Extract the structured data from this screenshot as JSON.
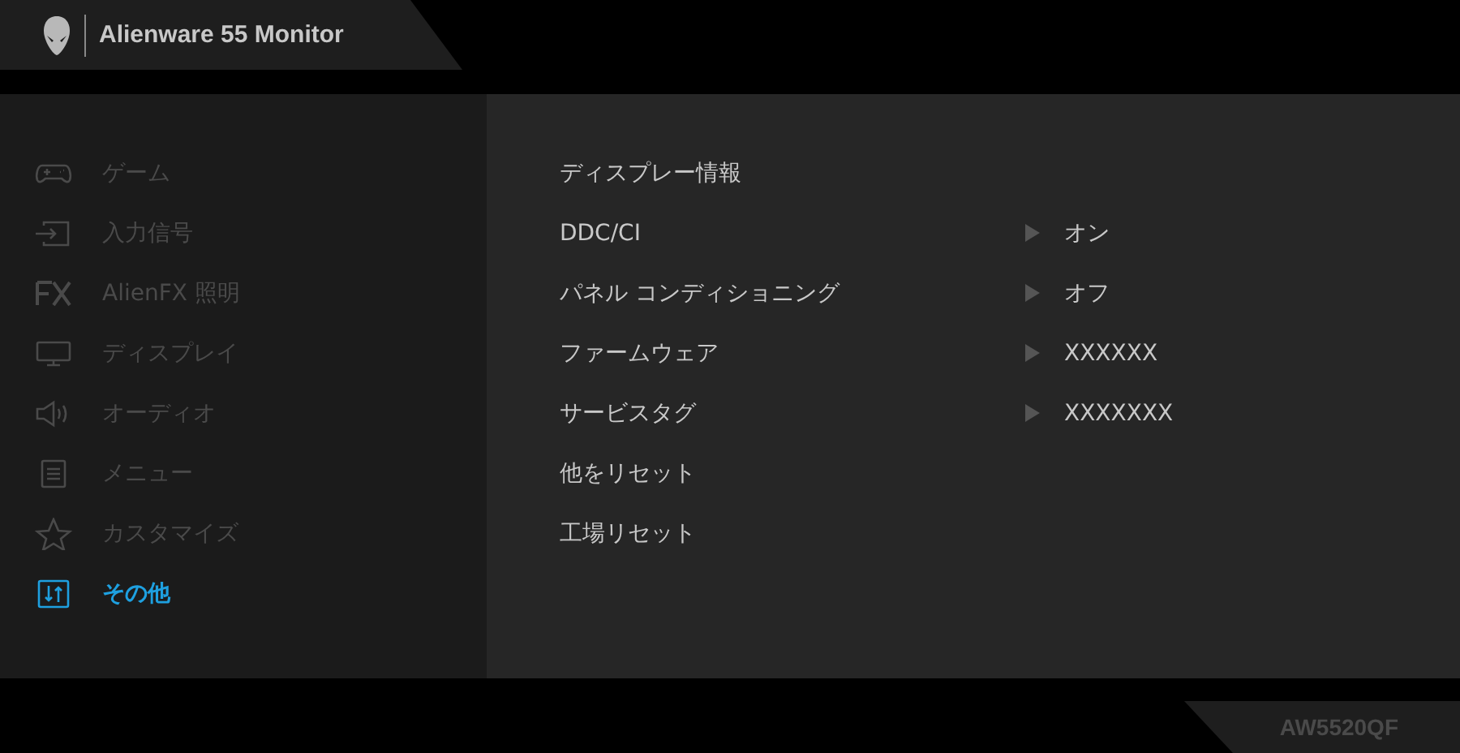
{
  "header": {
    "title": "Alienware 55 Monitor"
  },
  "sidebar": {
    "items": [
      {
        "kind": "game",
        "label": "ゲーム",
        "selected": false
      },
      {
        "kind": "input",
        "label": "入力信号",
        "selected": false
      },
      {
        "kind": "fx",
        "label": "AlienFX 照明",
        "selected": false
      },
      {
        "kind": "display",
        "label": "ディスプレイ",
        "selected": false
      },
      {
        "kind": "audio",
        "label": "オーディオ",
        "selected": false
      },
      {
        "kind": "menu",
        "label": "メニュー",
        "selected": false
      },
      {
        "kind": "star",
        "label": "カスタマイズ",
        "selected": false
      },
      {
        "kind": "other",
        "label": "その他",
        "selected": true
      }
    ]
  },
  "settings": [
    {
      "label": "ディスプレー情報"
    },
    {
      "label": "DDC/CI",
      "value": "オン"
    },
    {
      "label": "パネル コンディショニング",
      "value": "オフ"
    },
    {
      "label": "ファームウェア",
      "value": "XXXXXX"
    },
    {
      "label": "サービスタグ",
      "value": "XXXXXXX"
    },
    {
      "label": "他をリセット"
    },
    {
      "label": "工場リセット"
    }
  ],
  "footer": {
    "model": "AW5520QF"
  }
}
